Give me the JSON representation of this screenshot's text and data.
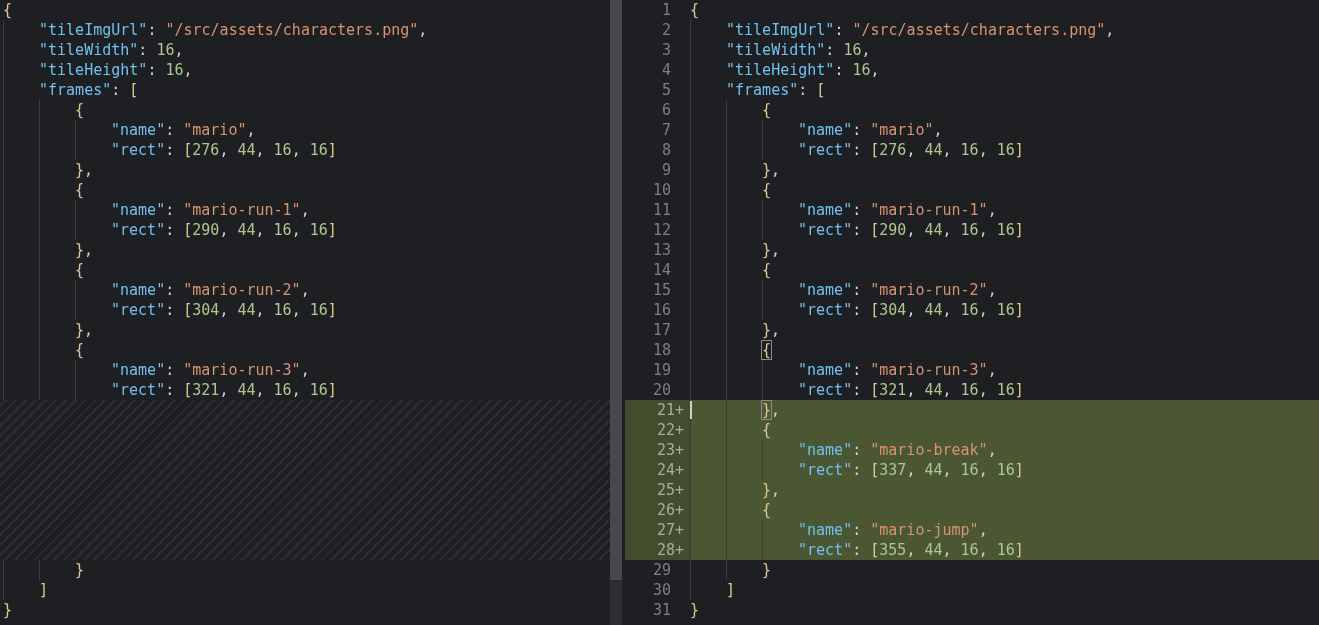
{
  "left_pane": {
    "lines": [
      {
        "kind": "code",
        "tokens": [
          {
            "kind": "open",
            "text": "{"
          }
        ]
      },
      {
        "kind": "code",
        "tokens": [
          {
            "kind": "key",
            "text": "\"tileImgUrl\""
          },
          {
            "kind": "punct",
            "text": ": "
          },
          {
            "kind": "str",
            "text": "\"/src/assets/characters.png\""
          },
          {
            "kind": "punct",
            "text": ","
          }
        ]
      },
      {
        "kind": "code",
        "tokens": [
          {
            "kind": "key",
            "text": "\"tileWidth\""
          },
          {
            "kind": "punct",
            "text": ": "
          },
          {
            "kind": "num",
            "text": "16"
          },
          {
            "kind": "punct",
            "text": ","
          }
        ]
      },
      {
        "kind": "code",
        "tokens": [
          {
            "kind": "key",
            "text": "\"tileHeight\""
          },
          {
            "kind": "punct",
            "text": ": "
          },
          {
            "kind": "num",
            "text": "16"
          },
          {
            "kind": "punct",
            "text": ","
          }
        ]
      },
      {
        "kind": "code",
        "tokens": [
          {
            "kind": "key",
            "text": "\"frames\""
          },
          {
            "kind": "punct",
            "text": ": "
          },
          {
            "kind": "open",
            "text": "["
          }
        ]
      },
      {
        "kind": "code",
        "tokens": [
          {
            "kind": "open",
            "text": "{"
          }
        ]
      },
      {
        "kind": "code",
        "tokens": [
          {
            "kind": "key",
            "text": "\"name\""
          },
          {
            "kind": "punct",
            "text": ": "
          },
          {
            "kind": "str",
            "text": "\"mario\""
          },
          {
            "kind": "punct",
            "text": ","
          }
        ]
      },
      {
        "kind": "code",
        "tokens": [
          {
            "kind": "key",
            "text": "\"rect\""
          },
          {
            "kind": "punct",
            "text": ": "
          },
          {
            "kind": "open",
            "text": "["
          },
          {
            "kind": "num",
            "text": "276"
          },
          {
            "kind": "punct",
            "text": ", "
          },
          {
            "kind": "num",
            "text": "44"
          },
          {
            "kind": "punct",
            "text": ", "
          },
          {
            "kind": "num",
            "text": "16"
          },
          {
            "kind": "punct",
            "text": ", "
          },
          {
            "kind": "num",
            "text": "16"
          },
          {
            "kind": "close",
            "text": "]"
          }
        ]
      },
      {
        "kind": "code",
        "tokens": [
          {
            "kind": "close",
            "text": "}"
          },
          {
            "kind": "punct",
            "text": ","
          }
        ]
      },
      {
        "kind": "code",
        "tokens": [
          {
            "kind": "open",
            "text": "{"
          }
        ]
      },
      {
        "kind": "code",
        "tokens": [
          {
            "kind": "key",
            "text": "\"name\""
          },
          {
            "kind": "punct",
            "text": ": "
          },
          {
            "kind": "str",
            "text": "\"mario-run-1\""
          },
          {
            "kind": "punct",
            "text": ","
          }
        ]
      },
      {
        "kind": "code",
        "tokens": [
          {
            "kind": "key",
            "text": "\"rect\""
          },
          {
            "kind": "punct",
            "text": ": "
          },
          {
            "kind": "open",
            "text": "["
          },
          {
            "kind": "num",
            "text": "290"
          },
          {
            "kind": "punct",
            "text": ", "
          },
          {
            "kind": "num",
            "text": "44"
          },
          {
            "kind": "punct",
            "text": ", "
          },
          {
            "kind": "num",
            "text": "16"
          },
          {
            "kind": "punct",
            "text": ", "
          },
          {
            "kind": "num",
            "text": "16"
          },
          {
            "kind": "close",
            "text": "]"
          }
        ]
      },
      {
        "kind": "code",
        "tokens": [
          {
            "kind": "close",
            "text": "}"
          },
          {
            "kind": "punct",
            "text": ","
          }
        ]
      },
      {
        "kind": "code",
        "tokens": [
          {
            "kind": "open",
            "text": "{"
          }
        ]
      },
      {
        "kind": "code",
        "tokens": [
          {
            "kind": "key",
            "text": "\"name\""
          },
          {
            "kind": "punct",
            "text": ": "
          },
          {
            "kind": "str",
            "text": "\"mario-run-2\""
          },
          {
            "kind": "punct",
            "text": ","
          }
        ]
      },
      {
        "kind": "code",
        "tokens": [
          {
            "kind": "key",
            "text": "\"rect\""
          },
          {
            "kind": "punct",
            "text": ": "
          },
          {
            "kind": "open",
            "text": "["
          },
          {
            "kind": "num",
            "text": "304"
          },
          {
            "kind": "punct",
            "text": ", "
          },
          {
            "kind": "num",
            "text": "44"
          },
          {
            "kind": "punct",
            "text": ", "
          },
          {
            "kind": "num",
            "text": "16"
          },
          {
            "kind": "punct",
            "text": ", "
          },
          {
            "kind": "num",
            "text": "16"
          },
          {
            "kind": "close",
            "text": "]"
          }
        ]
      },
      {
        "kind": "code",
        "tokens": [
          {
            "kind": "close",
            "text": "}"
          },
          {
            "kind": "punct",
            "text": ","
          }
        ]
      },
      {
        "kind": "code",
        "tokens": [
          {
            "kind": "open",
            "text": "{"
          }
        ]
      },
      {
        "kind": "code",
        "tokens": [
          {
            "kind": "key",
            "text": "\"name\""
          },
          {
            "kind": "punct",
            "text": ": "
          },
          {
            "kind": "str",
            "text": "\"mario-run-3\""
          },
          {
            "kind": "punct",
            "text": ","
          }
        ]
      },
      {
        "kind": "code",
        "tokens": [
          {
            "kind": "key",
            "text": "\"rect\""
          },
          {
            "kind": "punct",
            "text": ": "
          },
          {
            "kind": "open",
            "text": "["
          },
          {
            "kind": "num",
            "text": "321"
          },
          {
            "kind": "punct",
            "text": ", "
          },
          {
            "kind": "num",
            "text": "44"
          },
          {
            "kind": "punct",
            "text": ", "
          },
          {
            "kind": "num",
            "text": "16"
          },
          {
            "kind": "punct",
            "text": ", "
          },
          {
            "kind": "num",
            "text": "16"
          },
          {
            "kind": "close",
            "text": "]"
          }
        ]
      },
      {
        "kind": "gap"
      },
      {
        "kind": "code",
        "tokens": [
          {
            "kind": "close",
            "text": "}"
          }
        ]
      },
      {
        "kind": "code",
        "tokens": [
          {
            "kind": "close",
            "text": "]"
          }
        ]
      },
      {
        "kind": "code",
        "tokens": [
          {
            "kind": "close",
            "text": "}"
          }
        ]
      }
    ]
  },
  "right_pane": {
    "lines": [
      {
        "number": "1",
        "added": false,
        "tokens": [
          {
            "kind": "open",
            "text": "{"
          }
        ]
      },
      {
        "number": "2",
        "added": false,
        "tokens": [
          {
            "kind": "key",
            "text": "\"tileImgUrl\""
          },
          {
            "kind": "punct",
            "text": ": "
          },
          {
            "kind": "str",
            "text": "\"/src/assets/characters.png\""
          },
          {
            "kind": "punct",
            "text": ","
          }
        ]
      },
      {
        "number": "3",
        "added": false,
        "tokens": [
          {
            "kind": "key",
            "text": "\"tileWidth\""
          },
          {
            "kind": "punct",
            "text": ": "
          },
          {
            "kind": "num",
            "text": "16"
          },
          {
            "kind": "punct",
            "text": ","
          }
        ]
      },
      {
        "number": "4",
        "added": false,
        "tokens": [
          {
            "kind": "key",
            "text": "\"tileHeight\""
          },
          {
            "kind": "punct",
            "text": ": "
          },
          {
            "kind": "num",
            "text": "16"
          },
          {
            "kind": "punct",
            "text": ","
          }
        ]
      },
      {
        "number": "5",
        "added": false,
        "tokens": [
          {
            "kind": "key",
            "text": "\"frames\""
          },
          {
            "kind": "punct",
            "text": ": "
          },
          {
            "kind": "open",
            "text": "["
          }
        ]
      },
      {
        "number": "6",
        "added": false,
        "tokens": [
          {
            "kind": "open",
            "text": "{"
          }
        ]
      },
      {
        "number": "7",
        "added": false,
        "tokens": [
          {
            "kind": "key",
            "text": "\"name\""
          },
          {
            "kind": "punct",
            "text": ": "
          },
          {
            "kind": "str",
            "text": "\"mario\""
          },
          {
            "kind": "punct",
            "text": ","
          }
        ]
      },
      {
        "number": "8",
        "added": false,
        "tokens": [
          {
            "kind": "key",
            "text": "\"rect\""
          },
          {
            "kind": "punct",
            "text": ": "
          },
          {
            "kind": "open",
            "text": "["
          },
          {
            "kind": "num",
            "text": "276"
          },
          {
            "kind": "punct",
            "text": ", "
          },
          {
            "kind": "num",
            "text": "44"
          },
          {
            "kind": "punct",
            "text": ", "
          },
          {
            "kind": "num",
            "text": "16"
          },
          {
            "kind": "punct",
            "text": ", "
          },
          {
            "kind": "num",
            "text": "16"
          },
          {
            "kind": "close",
            "text": "]"
          }
        ]
      },
      {
        "number": "9",
        "added": false,
        "tokens": [
          {
            "kind": "close",
            "text": "}"
          },
          {
            "kind": "punct",
            "text": ","
          }
        ]
      },
      {
        "number": "10",
        "added": false,
        "tokens": [
          {
            "kind": "open",
            "text": "{"
          }
        ]
      },
      {
        "number": "11",
        "added": false,
        "tokens": [
          {
            "kind": "key",
            "text": "\"name\""
          },
          {
            "kind": "punct",
            "text": ": "
          },
          {
            "kind": "str",
            "text": "\"mario-run-1\""
          },
          {
            "kind": "punct",
            "text": ","
          }
        ]
      },
      {
        "number": "12",
        "added": false,
        "tokens": [
          {
            "kind": "key",
            "text": "\"rect\""
          },
          {
            "kind": "punct",
            "text": ": "
          },
          {
            "kind": "open",
            "text": "["
          },
          {
            "kind": "num",
            "text": "290"
          },
          {
            "kind": "punct",
            "text": ", "
          },
          {
            "kind": "num",
            "text": "44"
          },
          {
            "kind": "punct",
            "text": ", "
          },
          {
            "kind": "num",
            "text": "16"
          },
          {
            "kind": "punct",
            "text": ", "
          },
          {
            "kind": "num",
            "text": "16"
          },
          {
            "kind": "close",
            "text": "]"
          }
        ]
      },
      {
        "number": "13",
        "added": false,
        "tokens": [
          {
            "kind": "close",
            "text": "}"
          },
          {
            "kind": "punct",
            "text": ","
          }
        ]
      },
      {
        "number": "14",
        "added": false,
        "tokens": [
          {
            "kind": "open",
            "text": "{"
          }
        ]
      },
      {
        "number": "15",
        "added": false,
        "tokens": [
          {
            "kind": "key",
            "text": "\"name\""
          },
          {
            "kind": "punct",
            "text": ": "
          },
          {
            "kind": "str",
            "text": "\"mario-run-2\""
          },
          {
            "kind": "punct",
            "text": ","
          }
        ]
      },
      {
        "number": "16",
        "added": false,
        "tokens": [
          {
            "kind": "key",
            "text": "\"rect\""
          },
          {
            "kind": "punct",
            "text": ": "
          },
          {
            "kind": "open",
            "text": "["
          },
          {
            "kind": "num",
            "text": "304"
          },
          {
            "kind": "punct",
            "text": ", "
          },
          {
            "kind": "num",
            "text": "44"
          },
          {
            "kind": "punct",
            "text": ", "
          },
          {
            "kind": "num",
            "text": "16"
          },
          {
            "kind": "punct",
            "text": ", "
          },
          {
            "kind": "num",
            "text": "16"
          },
          {
            "kind": "close",
            "text": "]"
          }
        ]
      },
      {
        "number": "17",
        "added": false,
        "tokens": [
          {
            "kind": "close",
            "text": "}"
          },
          {
            "kind": "punct",
            "text": ","
          }
        ]
      },
      {
        "number": "18",
        "added": false,
        "tokens": [
          {
            "kind": "open",
            "text": "{",
            "matched": true
          }
        ]
      },
      {
        "number": "19",
        "added": false,
        "tokens": [
          {
            "kind": "key",
            "text": "\"name\""
          },
          {
            "kind": "punct",
            "text": ": "
          },
          {
            "kind": "str",
            "text": "\"mario-run-3\""
          },
          {
            "kind": "punct",
            "text": ","
          }
        ]
      },
      {
        "number": "20",
        "added": false,
        "tokens": [
          {
            "kind": "key",
            "text": "\"rect\""
          },
          {
            "kind": "punct",
            "text": ": "
          },
          {
            "kind": "open",
            "text": "["
          },
          {
            "kind": "num",
            "text": "321"
          },
          {
            "kind": "punct",
            "text": ", "
          },
          {
            "kind": "num",
            "text": "44"
          },
          {
            "kind": "punct",
            "text": ", "
          },
          {
            "kind": "num",
            "text": "16"
          },
          {
            "kind": "punct",
            "text": ", "
          },
          {
            "kind": "num",
            "text": "16"
          },
          {
            "kind": "close",
            "text": "]"
          }
        ]
      },
      {
        "number": "21+",
        "added": true,
        "cursor": true,
        "tokens": [
          {
            "kind": "close",
            "text": "}",
            "matched": true
          },
          {
            "kind": "punct",
            "text": ","
          }
        ]
      },
      {
        "number": "22+",
        "added": true,
        "tokens": [
          {
            "kind": "open",
            "text": "{"
          }
        ]
      },
      {
        "number": "23+",
        "added": true,
        "tokens": [
          {
            "kind": "key",
            "text": "\"name\""
          },
          {
            "kind": "punct",
            "text": ": "
          },
          {
            "kind": "str",
            "text": "\"mario-break\""
          },
          {
            "kind": "punct",
            "text": ","
          }
        ]
      },
      {
        "number": "24+",
        "added": true,
        "tokens": [
          {
            "kind": "key",
            "text": "\"rect\""
          },
          {
            "kind": "punct",
            "text": ": "
          },
          {
            "kind": "open",
            "text": "["
          },
          {
            "kind": "num",
            "text": "337"
          },
          {
            "kind": "punct",
            "text": ", "
          },
          {
            "kind": "num",
            "text": "44"
          },
          {
            "kind": "punct",
            "text": ", "
          },
          {
            "kind": "num",
            "text": "16"
          },
          {
            "kind": "punct",
            "text": ", "
          },
          {
            "kind": "num",
            "text": "16"
          },
          {
            "kind": "close",
            "text": "]"
          }
        ]
      },
      {
        "number": "25+",
        "added": true,
        "tokens": [
          {
            "kind": "close",
            "text": "}"
          },
          {
            "kind": "punct",
            "text": ","
          }
        ]
      },
      {
        "number": "26+",
        "added": true,
        "tokens": [
          {
            "kind": "open",
            "text": "{"
          }
        ]
      },
      {
        "number": "27+",
        "added": true,
        "tokens": [
          {
            "kind": "key",
            "text": "\"name\""
          },
          {
            "kind": "punct",
            "text": ": "
          },
          {
            "kind": "str",
            "text": "\"mario-jump\""
          },
          {
            "kind": "punct",
            "text": ","
          }
        ]
      },
      {
        "number": "28+",
        "added": true,
        "tokens": [
          {
            "kind": "key",
            "text": "\"rect\""
          },
          {
            "kind": "punct",
            "text": ": "
          },
          {
            "kind": "open",
            "text": "["
          },
          {
            "kind": "num",
            "text": "355"
          },
          {
            "kind": "punct",
            "text": ", "
          },
          {
            "kind": "num",
            "text": "44"
          },
          {
            "kind": "punct",
            "text": ", "
          },
          {
            "kind": "num",
            "text": "16"
          },
          {
            "kind": "punct",
            "text": ", "
          },
          {
            "kind": "num",
            "text": "16"
          },
          {
            "kind": "close",
            "text": "]"
          }
        ]
      },
      {
        "number": "29",
        "added": false,
        "tokens": [
          {
            "kind": "close",
            "text": "}"
          }
        ]
      },
      {
        "number": "30",
        "added": false,
        "tokens": [
          {
            "kind": "close",
            "text": "]"
          }
        ]
      },
      {
        "number": "31",
        "added": false,
        "tokens": [
          {
            "kind": "close",
            "text": "}"
          }
        ]
      }
    ]
  }
}
